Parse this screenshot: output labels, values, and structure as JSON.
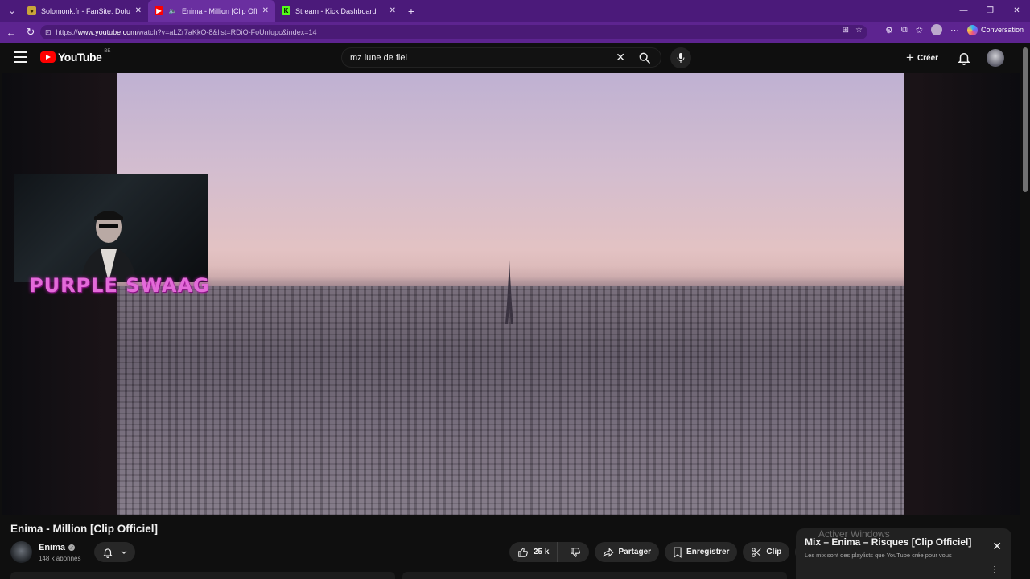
{
  "browser": {
    "tabs": [
      {
        "title": "Solomonk.fr - FanSite: Dofus Rétro",
        "favicon": "dofus-favicon",
        "active": false
      },
      {
        "title": "Enima - Million [Clip Officiel]",
        "favicon": "youtube-favicon",
        "active": true
      },
      {
        "title": "Stream - Kick Dashboard",
        "favicon": "kick-favicon",
        "active": false
      }
    ],
    "url_prefix": "https://",
    "url_host": "www.youtube.com",
    "url_path": "/watch?v=aLZr7aKkO-8&list=RDiO-FoUnfupc&index=14",
    "copilot_label": "Conversation",
    "colors": {
      "tabstrip": "#4b1a7a",
      "toolbar": "#5d2490"
    }
  },
  "youtube": {
    "logo_text": "YouTube",
    "country_code": "BE",
    "search_query": "mz lune de fiel",
    "create_label": "Créer"
  },
  "overlay": {
    "cam_label": "PURPLE SWAAG"
  },
  "video": {
    "title": "Enima - Million [Clip Officiel]",
    "channel_name": "Enima",
    "subscribers": "148 k abonnés",
    "likes": "25 k",
    "share_label": "Partager",
    "save_label": "Enregistrer",
    "clip_label": "Clip"
  },
  "mix": {
    "title": "Mix – Enima – Risques [Clip Officiel]",
    "subtitle": "Les mix sont des playlists que YouTube crée pour vous"
  },
  "watermark": {
    "text": "Activer Windows"
  }
}
